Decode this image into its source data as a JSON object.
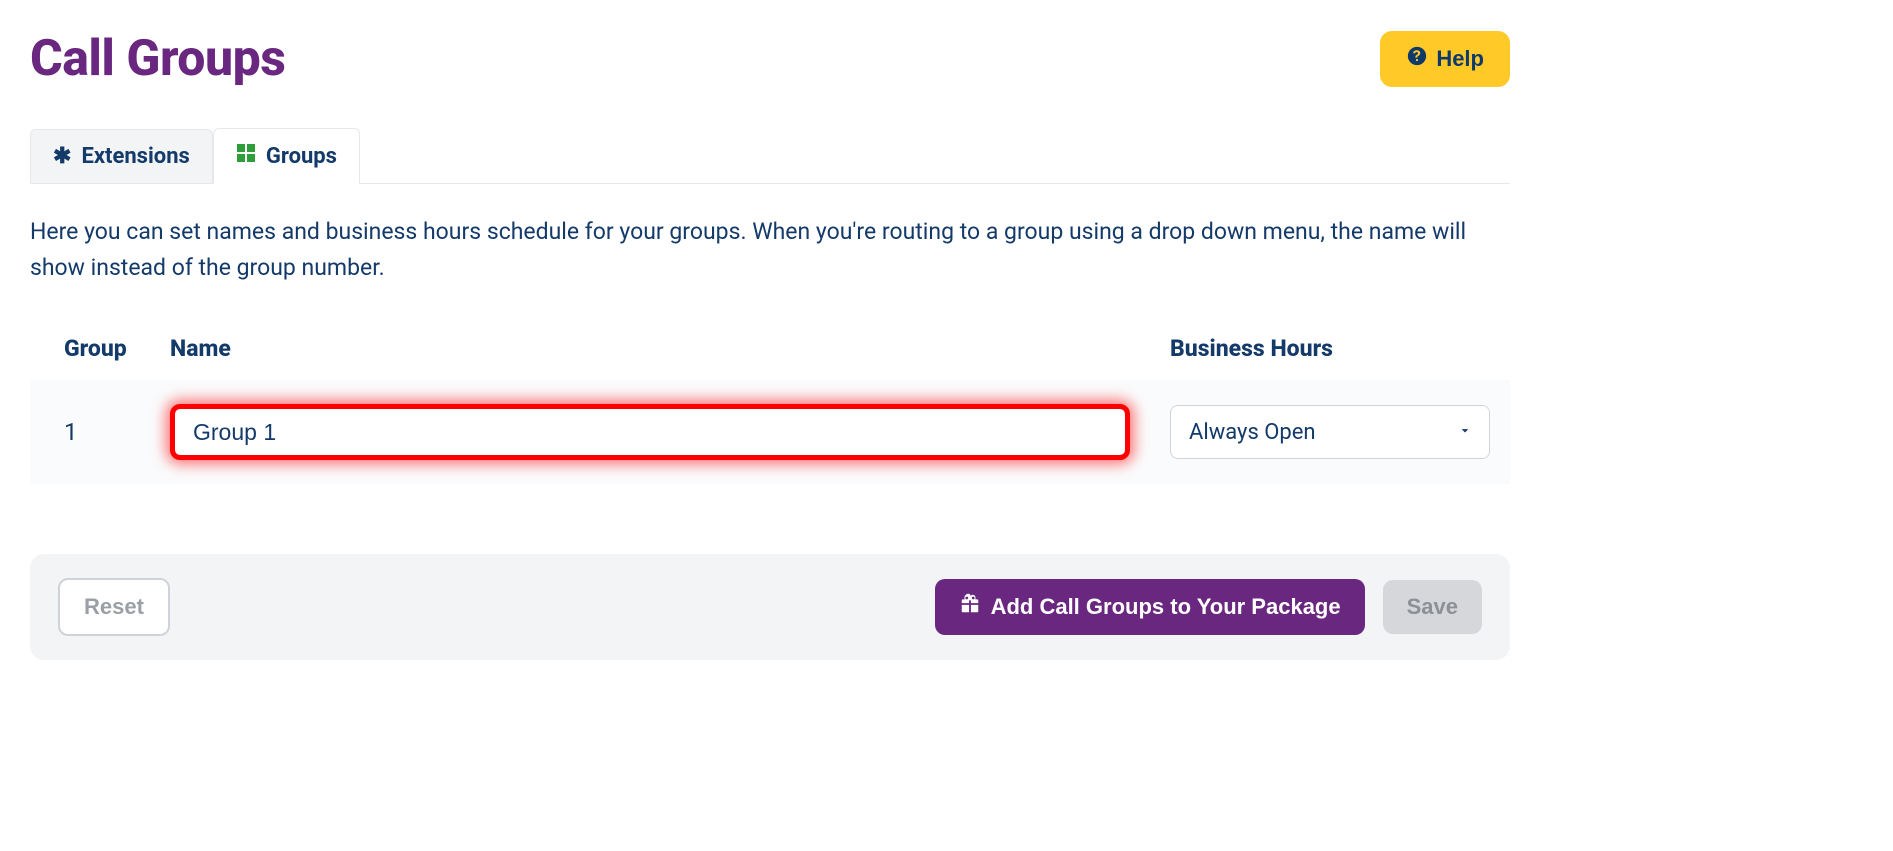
{
  "header": {
    "title": "Call Groups",
    "help_label": "Help"
  },
  "tabs": [
    {
      "id": "extensions",
      "label": "Extensions",
      "active": false,
      "icon": "asterisk"
    },
    {
      "id": "groups",
      "label": "Groups",
      "active": true,
      "icon": "grid"
    }
  ],
  "description": "Here you can set names and business hours schedule for your groups. When you're routing to a group using a drop down menu, the name will show instead of the group number.",
  "table": {
    "columns": {
      "group": "Group",
      "name": "Name",
      "hours": "Business Hours"
    },
    "rows": [
      {
        "group": "1",
        "name": "Group 1",
        "hours_selected": "Always Open",
        "highlight": true
      }
    ]
  },
  "footer": {
    "reset_label": "Reset",
    "add_label": "Add Call Groups to Your Package",
    "save_label": "Save"
  }
}
